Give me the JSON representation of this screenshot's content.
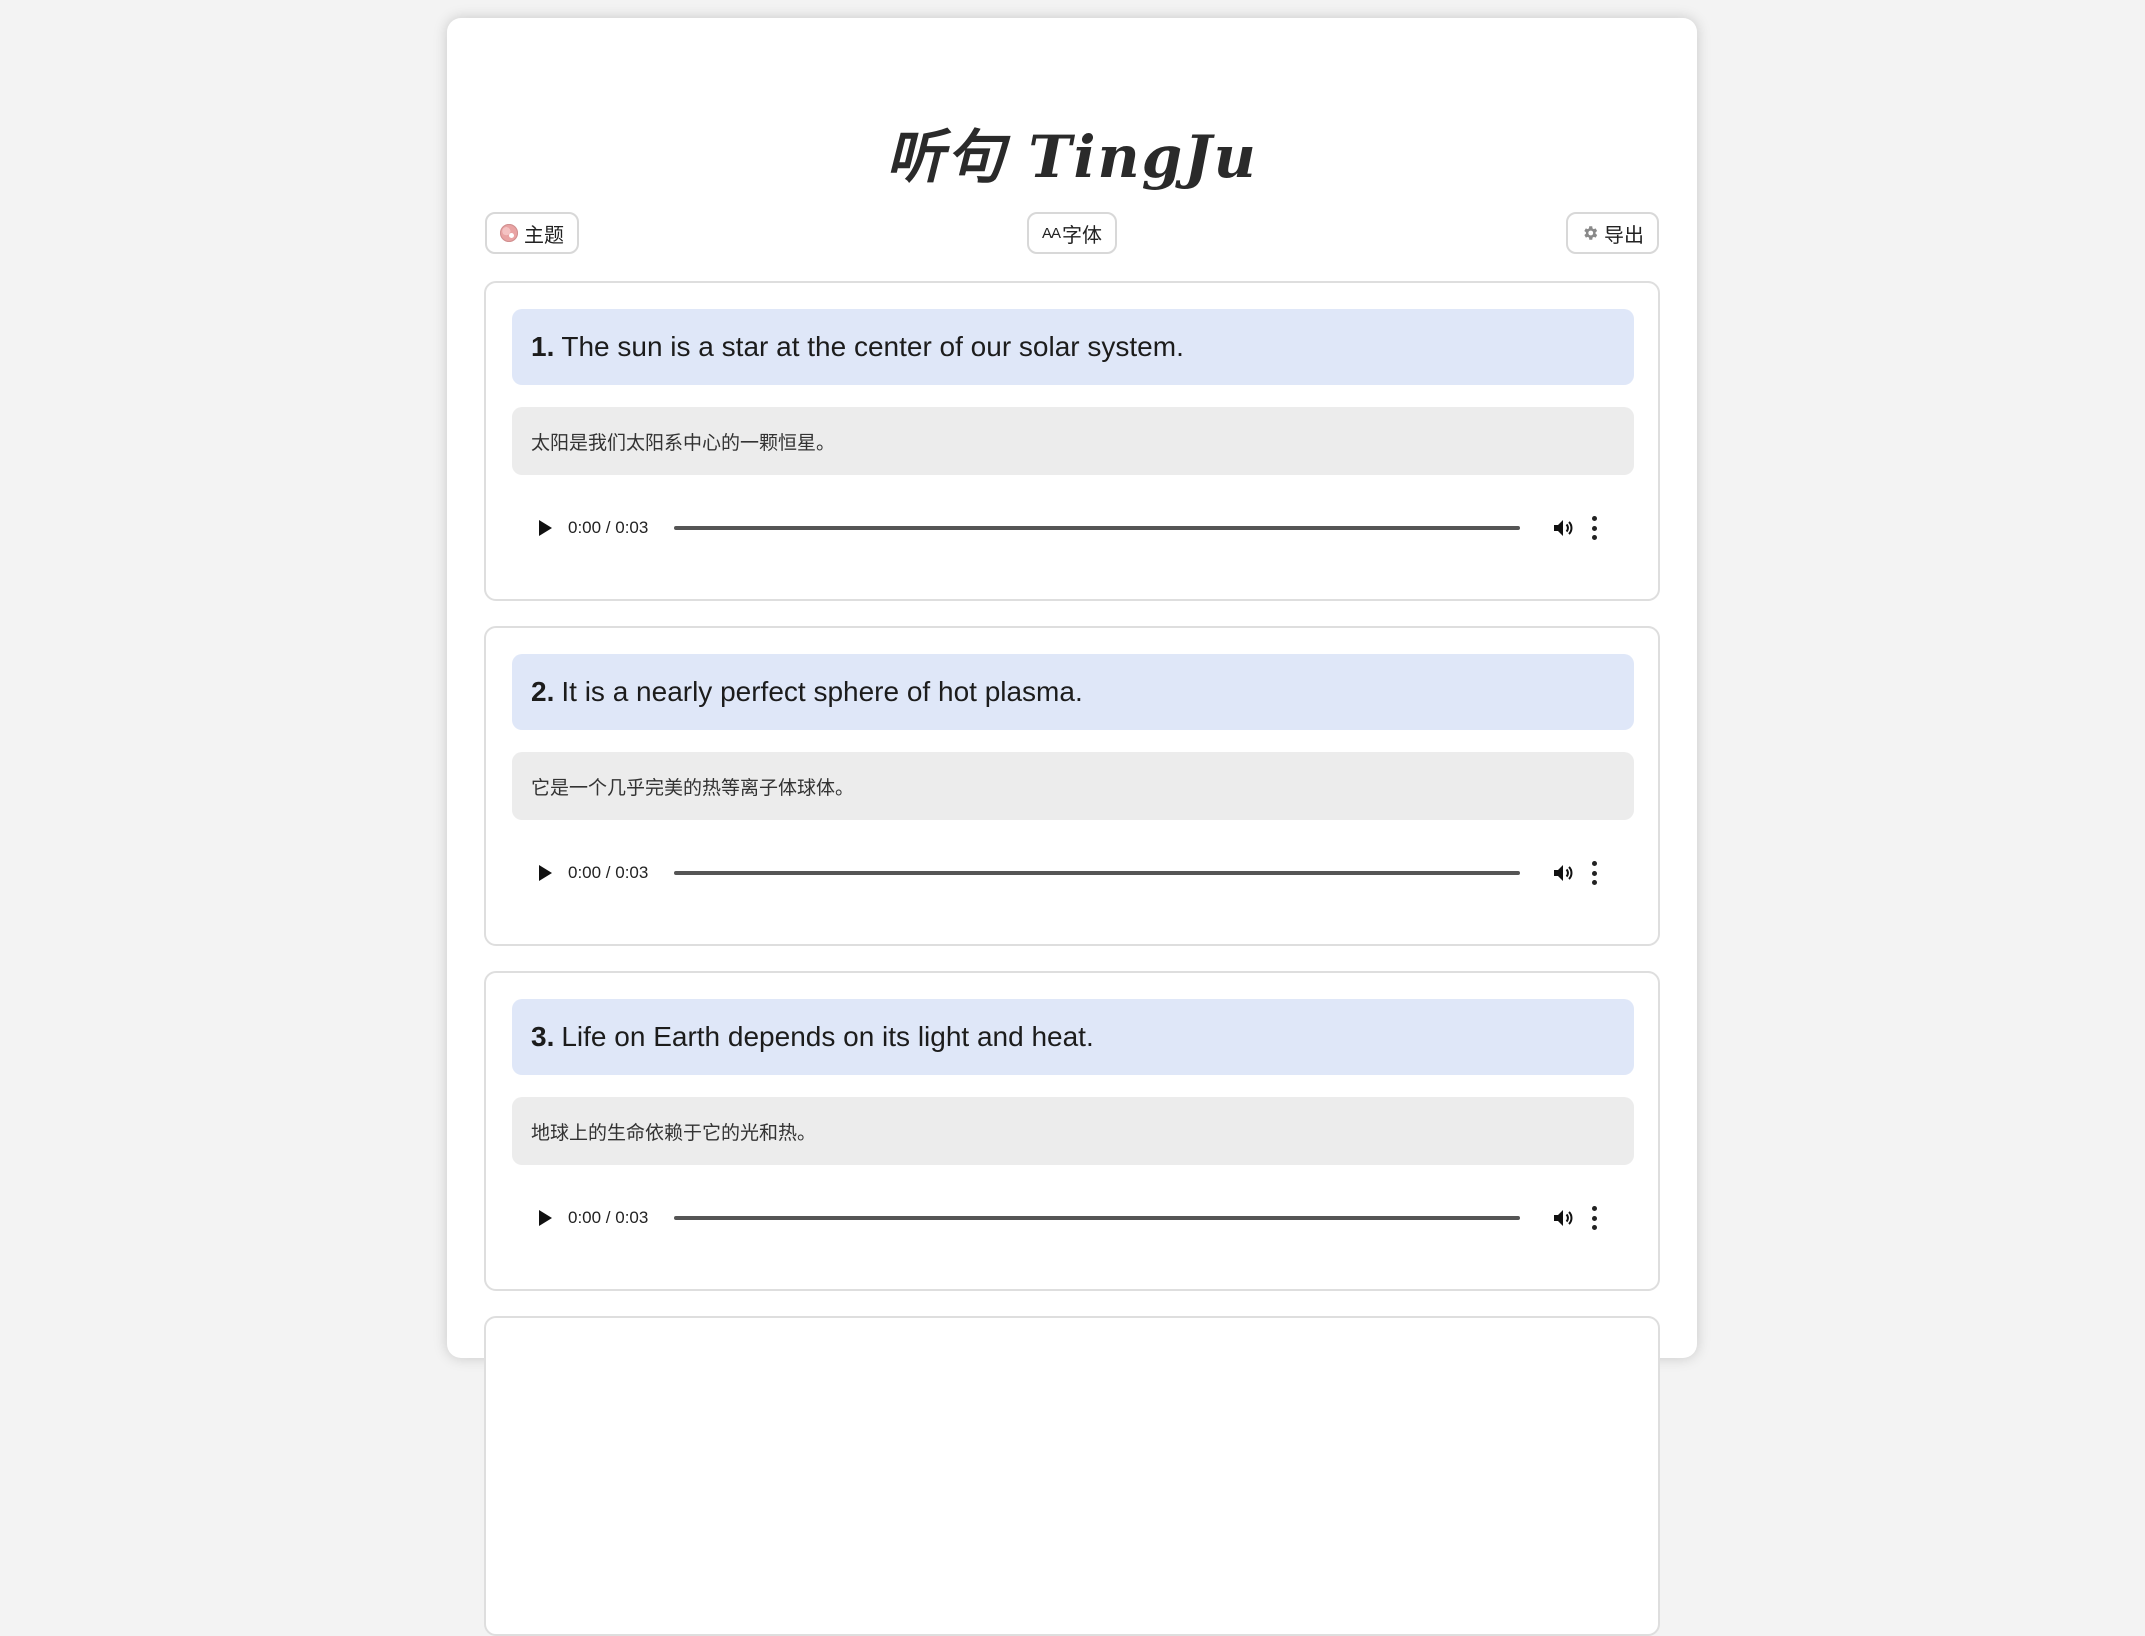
{
  "app": {
    "title": "听句 TingJu"
  },
  "toolbar": {
    "theme_label": "主题",
    "theme_icon": "palette-icon",
    "font_label": "字体",
    "font_icon_text": "AA",
    "font_icon": "font-size-icon",
    "export_label": "导出",
    "export_icon": "gear-icon"
  },
  "sentences": [
    {
      "number": "1.",
      "text": "The sun is a star at the center of our solar system.",
      "translation": "太阳是我们太阳系中心的一颗恒星。",
      "time": "0:00 / 0:03"
    },
    {
      "number": "2.",
      "text": "It is a nearly perfect sphere of hot plasma.",
      "translation": "它是一个几乎完美的热等离子体球体。",
      "time": "0:00 / 0:03"
    },
    {
      "number": "3.",
      "text": "Life on Earth depends on its light and heat.",
      "translation": "地球上的生命依赖于它的光和热。",
      "time": "0:00 / 0:03"
    }
  ],
  "colors": {
    "sentence_bg": "#dfe7f8",
    "translation_bg": "#ececec",
    "page_bg": "#f3f3f3"
  }
}
